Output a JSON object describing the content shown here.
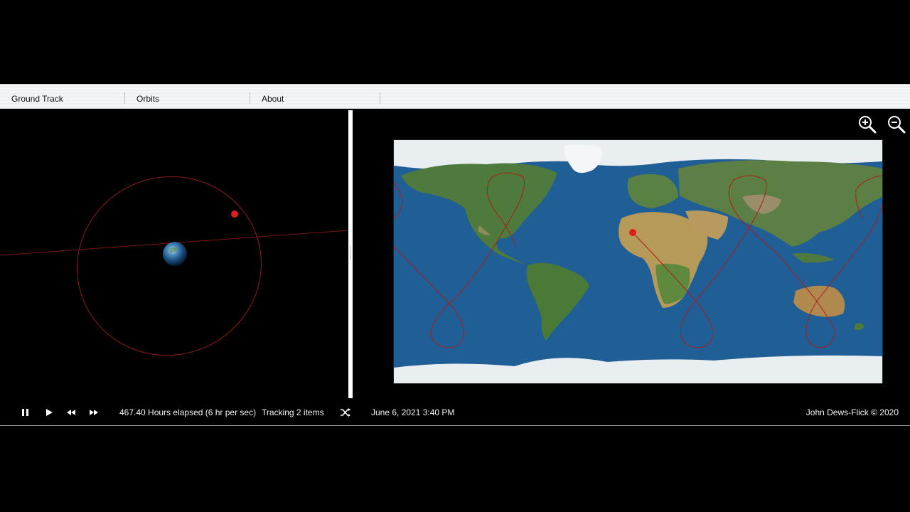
{
  "tabs": [
    {
      "label": "Ground Track"
    },
    {
      "label": "Orbits"
    },
    {
      "label": "About"
    }
  ],
  "colors": {
    "orbit": "#b22222",
    "satellite": "#e01e1e",
    "ocean": "#1f5f95",
    "tabbar": "#f2f4f6"
  },
  "icons": {
    "zoom_in": "zoom-in-icon",
    "zoom_out": "zoom-out-icon",
    "pause": "pause-icon",
    "play": "play-icon",
    "rewind": "rewind-icon",
    "fast_forward": "fast-forward-icon",
    "shuffle": "shuffle-icon"
  },
  "status": {
    "elapsed": "467.40 Hours elapsed (6 hr per sec)",
    "tracking": "Tracking 2 items",
    "datetime": "June 6, 2021 3:40 PM",
    "credit": "John Dews-Flick © 2020"
  }
}
